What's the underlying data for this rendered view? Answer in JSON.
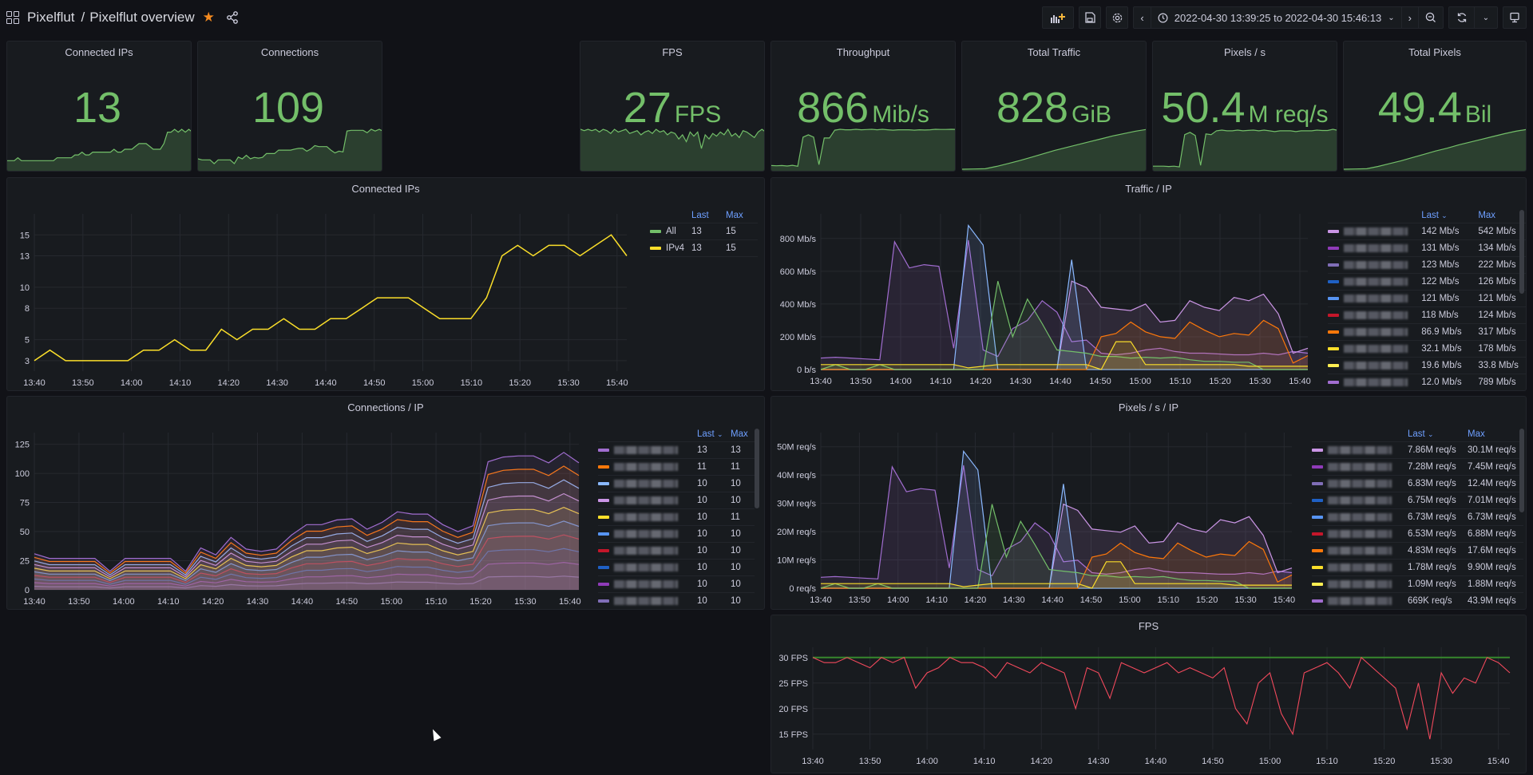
{
  "header": {
    "folder": "Pixelflut",
    "separator": "/",
    "dashboard": "Pixelflut overview",
    "starred": true,
    "time_range": "2022-04-30 13:39:25 to 2022-04-30 15:46:13",
    "icons": [
      "apps-icon",
      "star-icon",
      "share-icon",
      "add-panel-icon",
      "save-icon",
      "settings-icon",
      "chevron-left-icon",
      "clock-icon",
      "chevron-down-icon",
      "chevron-right-icon",
      "zoom-out-icon",
      "refresh-icon",
      "chevron-down-icon",
      "tv-icon"
    ]
  },
  "colors": {
    "stat_green": "#73bf69",
    "accent_blue": "#6e9fff",
    "fps_red": "#f2495c",
    "threshold_green": "#37872d",
    "ipv4_yellow": "#fade2a"
  },
  "stats": [
    {
      "title": "Connected IPs",
      "value": "13",
      "unit": "",
      "trend": [
        3,
        3,
        3,
        4,
        3,
        3,
        3,
        3,
        3,
        3,
        3,
        3,
        3,
        3,
        4,
        4,
        4,
        4,
        4,
        5,
        5,
        6,
        5,
        5,
        6,
        6,
        6,
        6,
        6,
        6,
        7,
        6,
        6,
        7,
        7,
        7,
        8,
        9,
        9,
        9,
        8,
        7,
        7,
        7,
        9,
        13,
        13,
        14,
        13,
        14,
        13,
        14,
        13
      ]
    },
    {
      "title": "Connections",
      "value": "109",
      "unit": "",
      "trend": [
        30,
        27,
        27,
        27,
        16,
        27,
        27,
        27,
        27,
        16,
        35,
        30,
        40,
        30,
        34,
        32,
        34,
        45,
        45,
        45,
        55,
        55,
        55,
        55,
        58,
        60,
        60,
        52,
        58,
        68,
        65,
        65,
        65,
        55,
        47,
        52,
        50,
        110,
        112,
        112,
        112,
        112,
        105,
        115,
        110,
        115,
        109
      ]
    },
    {
      "title": "FPS",
      "value": "27",
      "unit": "FPS",
      "trend": [
        29,
        28,
        29,
        28,
        29,
        27,
        29,
        28,
        26,
        29,
        27,
        28,
        29,
        26,
        27,
        28,
        25,
        27,
        28,
        26,
        29,
        27,
        28,
        25,
        27,
        26,
        22,
        25,
        20,
        27,
        24,
        27,
        15,
        25,
        22,
        26,
        24,
        27,
        25,
        29,
        24,
        26,
        23,
        28,
        27,
        25,
        23,
        27,
        29,
        27
      ]
    },
    {
      "title": "Throughput",
      "value": "866",
      "unit": "Mib/s",
      "trend": [
        80,
        75,
        80,
        70,
        85,
        65,
        700,
        750,
        700,
        100,
        680,
        680,
        850,
        870,
        860,
        860,
        870,
        860,
        865,
        870,
        860,
        870,
        860,
        850,
        860,
        860,
        860,
        850,
        860,
        855,
        860,
        870,
        866,
        866,
        870,
        866
      ]
    },
    {
      "title": "Total Traffic",
      "value": "828",
      "unit": "GiB",
      "trend": [
        0,
        5,
        10,
        60,
        120,
        180,
        250,
        320,
        390,
        450,
        510,
        570,
        630,
        690,
        740,
        790,
        828
      ]
    },
    {
      "title": "Pixels / s",
      "value": "50.4",
      "unit": "M req/s",
      "trend": [
        4,
        4,
        4,
        3.5,
        4,
        3,
        45,
        48,
        44,
        5,
        46,
        45,
        50,
        51,
        50,
        50,
        51,
        50,
        50.5,
        51,
        50,
        51,
        50,
        49,
        50,
        50,
        50,
        49,
        50,
        50,
        50,
        51,
        50.4,
        50.4,
        52,
        50.4
      ]
    },
    {
      "title": "Total Pixels",
      "value": "49.4",
      "unit": "Bil",
      "trend": [
        0,
        0.3,
        0.6,
        3.5,
        7,
        10.5,
        14.5,
        18.5,
        22.5,
        26,
        30,
        33.5,
        37,
        40.5,
        44,
        47,
        49.4
      ]
    }
  ],
  "panels": {
    "connected_ips": {
      "title": "Connected IPs",
      "legend_headers": [
        "Last",
        "Max"
      ],
      "legend": [
        {
          "name": "All",
          "color": "#73bf69",
          "last": "13",
          "max": "15"
        },
        {
          "name": "IPv4",
          "color": "#fade2a",
          "last": "13",
          "max": "15"
        }
      ]
    },
    "traffic_ip": {
      "title": "Traffic / IP",
      "legend_headers": [
        "Last",
        "Max"
      ],
      "sort_indicator": "chevron-down-icon",
      "legend": [
        {
          "color": "#ca95e5",
          "last": "142 Mb/s",
          "max": "542 Mb/s"
        },
        {
          "color": "#8f3bb8",
          "last": "131 Mb/s",
          "max": "134 Mb/s"
        },
        {
          "color": "#806eb7",
          "last": "123 Mb/s",
          "max": "222 Mb/s"
        },
        {
          "color": "#1f60c4",
          "last": "122 Mb/s",
          "max": "126 Mb/s"
        },
        {
          "color": "#5794f2",
          "last": "121 Mb/s",
          "max": "121 Mb/s"
        },
        {
          "color": "#c4162a",
          "last": "118 Mb/s",
          "max": "124 Mb/s"
        },
        {
          "color": "#ff780a",
          "last": "86.9 Mb/s",
          "max": "317 Mb/s"
        },
        {
          "color": "#fade2a",
          "last": "32.1 Mb/s",
          "max": "178 Mb/s"
        },
        {
          "color": "#ffee52",
          "last": "19.6 Mb/s",
          "max": "33.8 Mb/s"
        },
        {
          "color": "#a16dd0",
          "last": "12.0 Mb/s",
          "max": "789 Mb/s"
        }
      ]
    },
    "connections_ip": {
      "title": "Connections / IP",
      "legend_headers": [
        "Last",
        "Max"
      ],
      "sort_indicator": "chevron-down-icon",
      "legend": [
        {
          "color": "#a16dd0",
          "last": "13",
          "max": "13"
        },
        {
          "color": "#ff780a",
          "last": "11",
          "max": "11"
        },
        {
          "color": "#8ab8ff",
          "last": "10",
          "max": "10"
        },
        {
          "color": "#ca95e5",
          "last": "10",
          "max": "10"
        },
        {
          "color": "#fade2a",
          "last": "10",
          "max": "11"
        },
        {
          "color": "#5794f2",
          "last": "10",
          "max": "10"
        },
        {
          "color": "#c4162a",
          "last": "10",
          "max": "10"
        },
        {
          "color": "#1f60c4",
          "last": "10",
          "max": "10"
        },
        {
          "color": "#8f3bb8",
          "last": "10",
          "max": "10"
        },
        {
          "color": "#806eb7",
          "last": "10",
          "max": "10"
        }
      ]
    },
    "pixels_ip": {
      "title": "Pixels / s / IP",
      "legend_headers": [
        "Last",
        "Max"
      ],
      "sort_indicator": "chevron-down-icon",
      "legend": [
        {
          "color": "#ca95e5",
          "last": "7.86M req/s",
          "max": "30.1M req/s"
        },
        {
          "color": "#8f3bb8",
          "last": "7.28M req/s",
          "max": "7.45M req/s"
        },
        {
          "color": "#806eb7",
          "last": "6.83M req/s",
          "max": "12.4M req/s"
        },
        {
          "color": "#1f60c4",
          "last": "6.75M req/s",
          "max": "7.01M req/s"
        },
        {
          "color": "#5794f2",
          "last": "6.73M req/s",
          "max": "6.73M req/s"
        },
        {
          "color": "#c4162a",
          "last": "6.53M req/s",
          "max": "6.88M req/s"
        },
        {
          "color": "#ff780a",
          "last": "4.83M req/s",
          "max": "17.6M req/s"
        },
        {
          "color": "#fade2a",
          "last": "1.78M req/s",
          "max": "9.90M req/s"
        },
        {
          "color": "#ffee52",
          "last": "1.09M req/s",
          "max": "1.88M req/s"
        },
        {
          "color": "#a16dd0",
          "last": "669K req/s",
          "max": "43.9M req/s"
        }
      ]
    },
    "fps": {
      "title": "FPS"
    }
  },
  "chart_data": [
    {
      "type": "line",
      "title": "Connected IPs",
      "x": [
        "13:40",
        "13:50",
        "14:00",
        "14:10",
        "14:20",
        "14:30",
        "14:40",
        "14:50",
        "15:00",
        "15:10",
        "15:20",
        "15:30",
        "15:40"
      ],
      "yticks": [
        "3",
        "5",
        "8",
        "10",
        "13",
        "15"
      ],
      "ylim": [
        2,
        17
      ],
      "series": [
        {
          "name": "IPv4",
          "color": "#fade2a",
          "values": [
            3,
            4,
            3,
            3,
            3,
            3,
            3,
            4,
            4,
            5,
            4,
            4,
            6,
            5,
            6,
            6,
            7,
            6,
            6,
            7,
            7,
            8,
            9,
            9,
            9,
            8,
            7,
            7,
            7,
            9,
            13,
            14,
            13,
            14,
            14,
            13,
            14,
            15,
            13
          ]
        }
      ]
    },
    {
      "type": "area",
      "title": "Traffic / IP",
      "x": [
        "13:40",
        "13:50",
        "14:00",
        "14:10",
        "14:20",
        "14:30",
        "14:40",
        "14:50",
        "15:00",
        "15:10",
        "15:20",
        "15:30",
        "15:40"
      ],
      "yticks": [
        "0 b/s",
        "200 Mb/s",
        "400 Mb/s",
        "600 Mb/s",
        "800 Mb/s"
      ],
      "ylim": [
        0,
        950
      ],
      "series": [
        {
          "name": "purple-1",
          "color": "#a16dd0",
          "values": [
            70,
            75,
            70,
            65,
            60,
            780,
            620,
            640,
            630,
            130,
            790,
            120,
            80,
            250,
            300,
            420,
            350,
            170,
            180,
            100,
            90,
            100,
            120,
            130,
            110,
            100,
            100,
            95,
            90,
            90,
            100,
            90,
            110,
            100
          ]
        },
        {
          "name": "violet-main",
          "color": "#ca95e5",
          "values": [
            0,
            0,
            0,
            0,
            0,
            0,
            0,
            0,
            0,
            0,
            0,
            0,
            0,
            0,
            0,
            0,
            0,
            540,
            500,
            380,
            370,
            360,
            400,
            290,
            300,
            420,
            380,
            360,
            440,
            420,
            460,
            340,
            100,
            130
          ]
        },
        {
          "name": "blue",
          "color": "#8ab8ff",
          "values": [
            0,
            0,
            0,
            0,
            0,
            0,
            0,
            0,
            0,
            0,
            880,
            760,
            0,
            0,
            0,
            0,
            0,
            670,
            0,
            0,
            0,
            0,
            0,
            0,
            0,
            0,
            0,
            0,
            0,
            0,
            0,
            0,
            0,
            0
          ]
        },
        {
          "name": "orange",
          "color": "#ff780a",
          "values": [
            0,
            0,
            0,
            0,
            0,
            0,
            0,
            0,
            0,
            0,
            0,
            0,
            0,
            0,
            0,
            0,
            0,
            0,
            0,
            200,
            220,
            290,
            230,
            200,
            190,
            290,
            240,
            200,
            220,
            210,
            300,
            250,
            40,
            85
          ]
        },
        {
          "name": "green",
          "color": "#73bf69",
          "values": [
            0,
            30,
            0,
            0,
            30,
            0,
            0,
            0,
            0,
            0,
            0,
            0,
            540,
            200,
            430,
            280,
            120,
            110,
            100,
            80,
            80,
            70,
            75,
            70,
            75,
            60,
            50,
            50,
            45,
            45,
            0,
            0,
            0,
            0
          ]
        },
        {
          "name": "yellow",
          "color": "#fade2a",
          "values": [
            30,
            30,
            30,
            30,
            30,
            30,
            30,
            30,
            30,
            30,
            10,
            20,
            30,
            30,
            30,
            30,
            30,
            30,
            30,
            0,
            170,
            170,
            30,
            30,
            30,
            30,
            30,
            30,
            30,
            20,
            20,
            20,
            20,
            20
          ]
        }
      ]
    },
    {
      "type": "area",
      "title": "Connections / IP",
      "stacked": true,
      "x": [
        "13:40",
        "13:50",
        "14:00",
        "14:10",
        "14:20",
        "14:30",
        "14:40",
        "14:50",
        "15:00",
        "15:10",
        "15:20",
        "15:30",
        "15:40"
      ],
      "yticks": [
        "0",
        "25",
        "50",
        "75",
        "100",
        "125"
      ],
      "ylim": [
        0,
        135
      ],
      "total": [
        31,
        27,
        27,
        27,
        27,
        16,
        27,
        27,
        27,
        27,
        16,
        36,
        30,
        45,
        35,
        33,
        35,
        47,
        56,
        56,
        60,
        61,
        52,
        58,
        67,
        65,
        65,
        56,
        50,
        55,
        110,
        114,
        115,
        115,
        109,
        118,
        109
      ]
    },
    {
      "type": "area",
      "title": "Pixels / s / IP",
      "x": [
        "13:40",
        "13:50",
        "14:00",
        "14:10",
        "14:20",
        "14:30",
        "14:40",
        "14:50",
        "15:00",
        "15:10",
        "15:20",
        "15:30",
        "15:40"
      ],
      "yticks": [
        "0 req/s",
        "10M req/s",
        "20M req/s",
        "30M req/s",
        "40M req/s",
        "50M req/s"
      ],
      "ylim": [
        0,
        55
      ]
    },
    {
      "type": "line",
      "title": "FPS",
      "x": [
        "13:40",
        "13:50",
        "14:00",
        "14:10",
        "14:20",
        "14:30",
        "14:40",
        "14:50",
        "15:00",
        "15:10",
        "15:20",
        "15:30",
        "15:40"
      ],
      "yticks": [
        "15 FPS",
        "20 FPS",
        "25 FPS",
        "30 FPS"
      ],
      "ylim": [
        12,
        32
      ],
      "threshold": 30,
      "series": [
        {
          "name": "FPS",
          "color": "#f2495c",
          "values": [
            30,
            29,
            29,
            30,
            29,
            28,
            30,
            29,
            30,
            24,
            27,
            28,
            30,
            29,
            29,
            28,
            26,
            29,
            28,
            27,
            29,
            28,
            27,
            20,
            28,
            27,
            22,
            29,
            28,
            27,
            28,
            29,
            27,
            28,
            27,
            26,
            28,
            20,
            17,
            25,
            27,
            19,
            15,
            27,
            28,
            29,
            27,
            24,
            30,
            28,
            26,
            24,
            16,
            25,
            14,
            27,
            23,
            26,
            25,
            30,
            29,
            27
          ]
        }
      ]
    }
  ]
}
